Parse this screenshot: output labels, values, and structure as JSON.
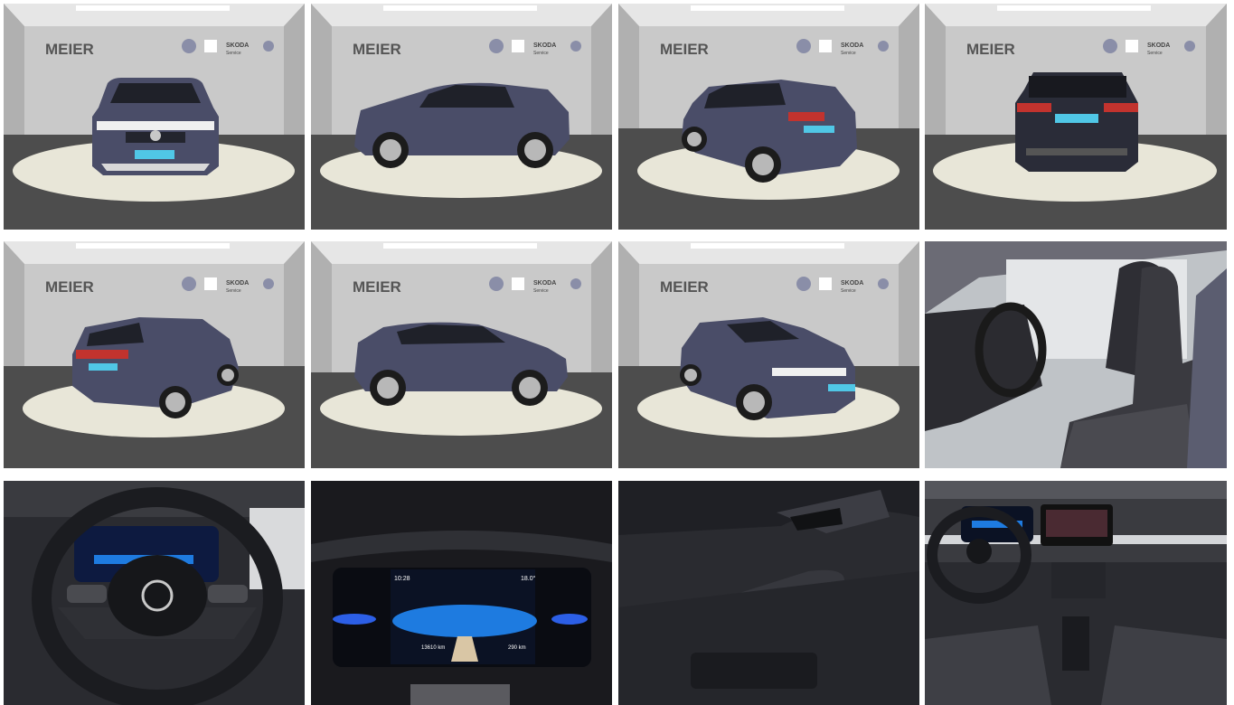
{
  "gallery": {
    "photos": [
      {
        "view": "exterior front",
        "dealer_logo": "MEIER",
        "brand_text": "SKODA",
        "brand_sub": "Service"
      },
      {
        "view": "exterior side left",
        "dealer_logo": "MEIER",
        "brand_text": "SKODA",
        "brand_sub": "Service"
      },
      {
        "view": "exterior rear three-quarter left",
        "dealer_logo": "MEIER",
        "brand_text": "SKODA",
        "brand_sub": "Service"
      },
      {
        "view": "exterior rear",
        "dealer_logo": "MEIER",
        "brand_text": "SKODA",
        "brand_sub": "Service"
      },
      {
        "view": "exterior rear three-quarter right",
        "dealer_logo": "MEIER",
        "brand_text": "SKODA",
        "brand_sub": "Service"
      },
      {
        "view": "exterior side right",
        "dealer_logo": "MEIER",
        "brand_text": "SKODA",
        "brand_sub": "Service"
      },
      {
        "view": "exterior front three-quarter right",
        "dealer_logo": "MEIER",
        "brand_text": "SKODA",
        "brand_sub": "Service"
      },
      {
        "view": "interior front seats"
      },
      {
        "view": "steering wheel"
      },
      {
        "view": "digital cockpit",
        "time": "10:28",
        "temp": "18.0°",
        "odometer": "13610 km",
        "range": "290 km"
      },
      {
        "view": "door panel"
      },
      {
        "view": "dashboard overview"
      }
    ]
  },
  "colors": {
    "car_paint": "#4a4d68",
    "showroom_wall": "#c9c9c9",
    "floor": "#4d4d4d",
    "turntable": "#e8e6d8",
    "cockpit_blue": "#1e7be0",
    "dealer_red": "#c0282d"
  }
}
